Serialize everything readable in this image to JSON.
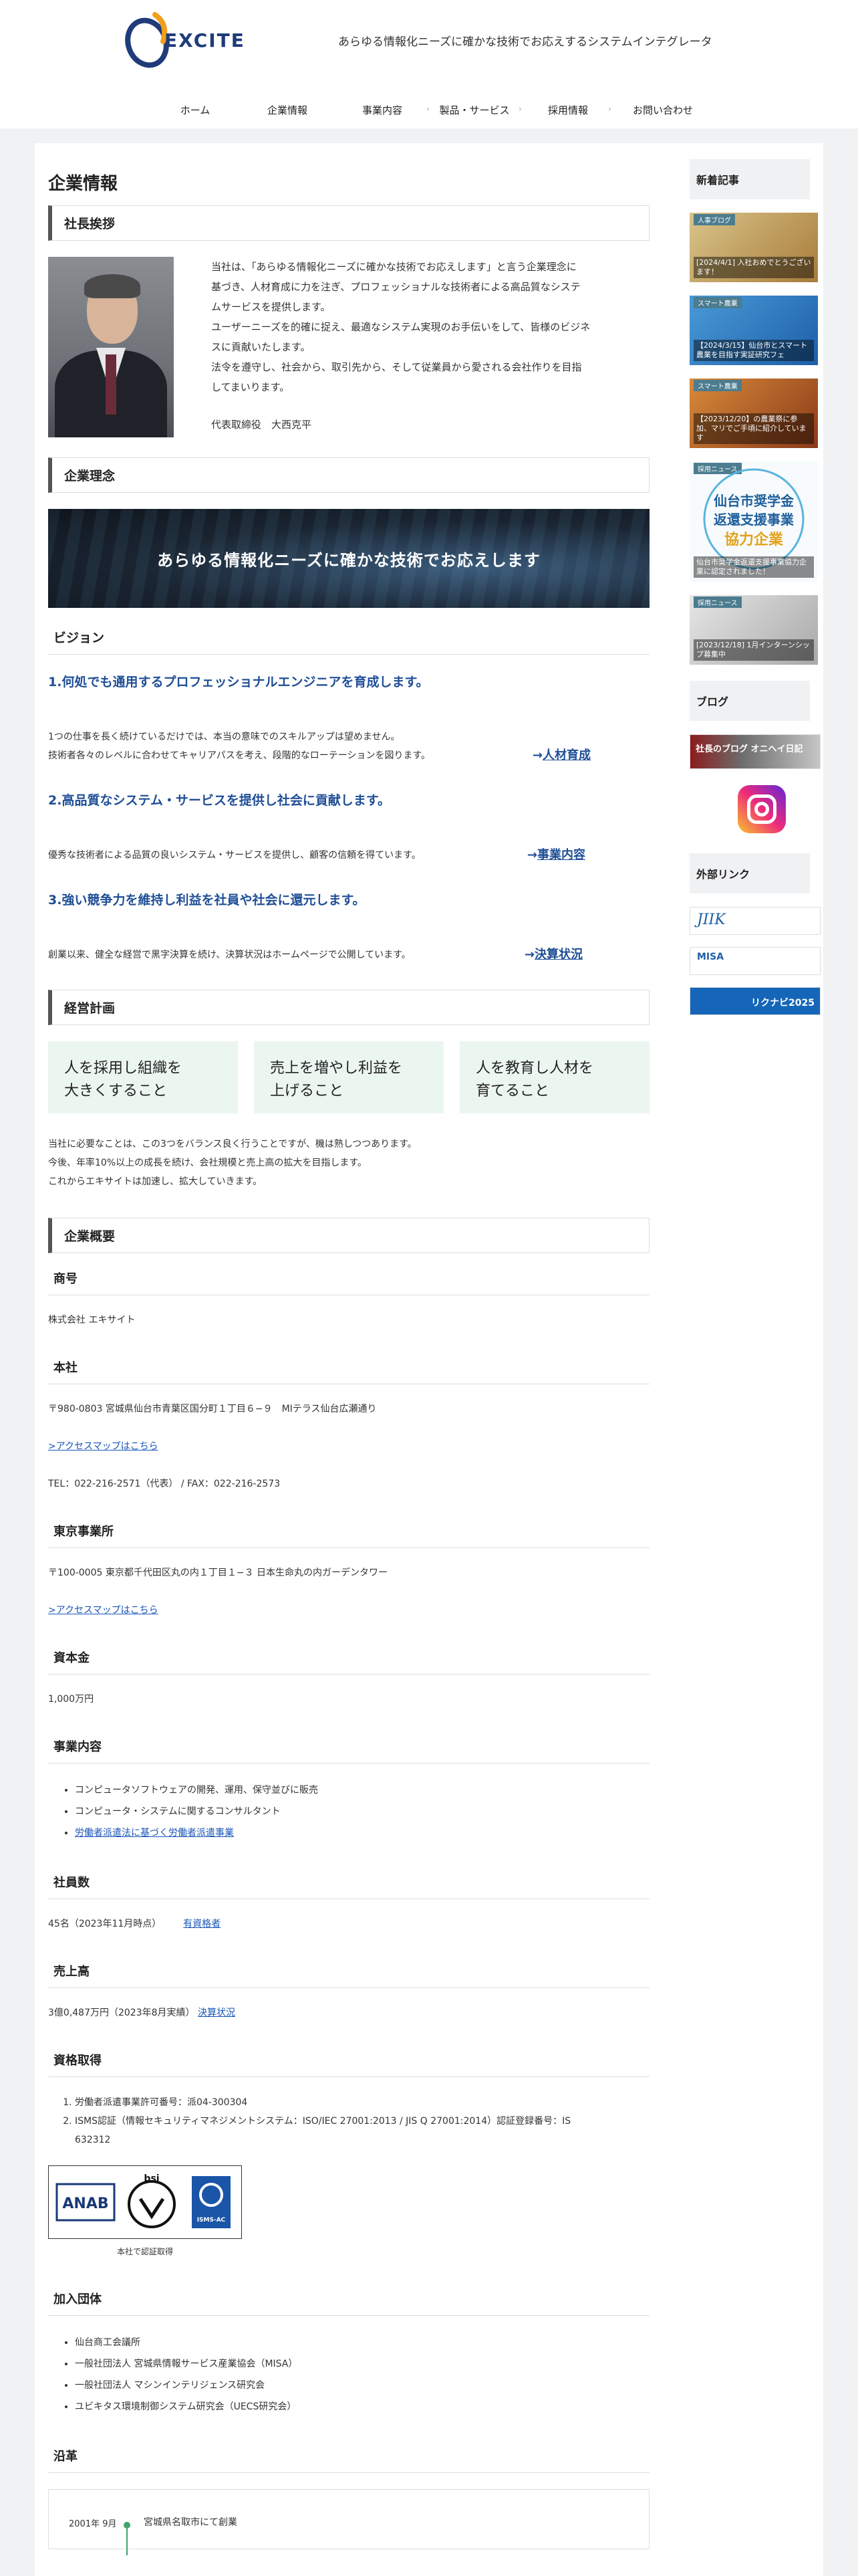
{
  "header": {
    "logo_text": "EXCITE",
    "tagline": "あらゆる情報化ニーズに確かな技術でお応えするシステムインテグレータ"
  },
  "nav": [
    "ホーム",
    "企業情報",
    "事業内容",
    "製品・サービス",
    "採用情報",
    "お問い合わせ"
  ],
  "page_title": "企業情報",
  "greeting": {
    "heading": "社長挨拶",
    "paragraphs": [
      "当社は、「あらゆる情報化ニーズに確かな技術でお応えします」と言う企業理念に",
      "基づき、人材育成に力を注ぎ、プロフェッショナルな技術者による高品質なシステ",
      "ムサービスを提供します。",
      "ユーザーニーズを的確に捉え、最適なシステム実現のお手伝いをして、皆様のビジネ",
      "スに貢献いたします。",
      "法令を遵守し、社会から、取引先から、そして従業員から愛される会社作りを目指",
      "してまいります。"
    ],
    "signature": "代表取締役　大西克平"
  },
  "philosophy": {
    "heading": "企業理念",
    "banner": "あらゆる情報化ニーズに確かな技術でお応えします"
  },
  "vision": {
    "heading": "ビジョン",
    "items": [
      {
        "title": "1.何処でも通用するプロフェッショナルエンジニアを育成します。",
        "body": [
          "1つの仕事を長く続けているだけでは、本当の意味でのスキルアップは望めません。",
          "技術者各々のレベルに合わせてキャリアパスを考え、段階的なローテーションを図ります。"
        ],
        "link": "人材育成"
      },
      {
        "title": "2.高品質なシステム・サービスを提供し社会に貢献します。",
        "body": [
          "優秀な技術者による品質の良いシステム・サービスを提供し、顧客の信頼を得ています。"
        ],
        "link": "事業内容"
      },
      {
        "title": "3.強い競争力を維持し利益を社員や社会に還元します。",
        "body": [
          "創業以来、健全な経営で黒字決算を続け、決算状況はホームページで公開しています。"
        ],
        "link": "決算状況"
      }
    ]
  },
  "plan": {
    "heading": "経営計画",
    "cards": [
      [
        "人を採用し組織を",
        "大きくすること"
      ],
      [
        "売上を増やし利益を",
        "上げること"
      ],
      [
        "人を教育し人材を",
        "育てること"
      ]
    ],
    "note": [
      "当社に必要なことは、この3つをバランス良く行うことですが、機は熟しつつあります。",
      "今後、年率10%以上の成長を続け、会社規模と売上高の拡大を目指します。",
      "これからエキサイトは加速し、拡大していきます。"
    ]
  },
  "overview": {
    "heading": "企業概要",
    "name_label": "商号",
    "name_value": "株式会社 エキサイト",
    "hq_label": "本社",
    "hq_address": "〒980-0803 宮城県仙台市青葉区国分町１丁目６−９　MIテラス仙台広瀬通り",
    "hq_map": ">アクセスマップはこちら",
    "hq_tel": "TEL：022-216-2571（代表） / FAX：022-216-2573",
    "tokyo_label": "東京事業所",
    "tokyo_address": "〒100-0005 東京都千代田区丸の内１丁目１−３ 日本生命丸の内ガーデンタワー",
    "tokyo_map": ">アクセスマップはこちら",
    "capital_label": "資本金",
    "capital_value": "1,000万円",
    "biz_label": "事業内容",
    "biz_items": [
      "コンピュータソフトウェアの開発、運用、保守並びに販売",
      "コンピュータ・システムに関するコンサルタント"
    ],
    "biz_link": "労働者派遣法に基づく労働者派遣事業",
    "staff_label": "社員数",
    "staff_value": "45名（2023年11月時点）",
    "staff_link": "有資格者",
    "sales_label": "売上高",
    "sales_value": "3億0,487万円（2023年8月実績）",
    "sales_link": "決算状況",
    "cert_label": "資格取得",
    "cert_items": [
      "労働者派遣事業許可番号：派04-300304",
      "ISMS認証（情報セキュリティマネジメントシステム：ISO/IEC 27001:2013 / JIS Q 27001:2014）認証登録番号：IS"
    ],
    "cert_item_cont": "632312",
    "cert_caption": "本社で認証取得",
    "cert_logos": [
      "ANAB",
      "bsi",
      "ISMS-AC"
    ],
    "member_label": "加入団体",
    "member_items": [
      "仙台商工会議所",
      "一般社団法人 宮城県情報サービス産業協会（MISA）",
      "一般社団法人 マシンインテリジェンス研究会",
      "ユビキタス環境制御システム研究会（UECS研究会）"
    ],
    "history_label": "沿革",
    "history_date": "2001年 9月",
    "history_event": "宮城県名取市にて創業"
  },
  "sidebar": {
    "news_heading": "新着記事",
    "news": [
      {
        "tag": "人事ブログ",
        "caption": "[2024/4/1] 入社おめでとうございます！"
      },
      {
        "tag": "スマート農業",
        "caption": "【2024/3/15】仙台市とスマート農業を目指す実証研究フェ"
      },
      {
        "tag": "スマート農業",
        "caption": "【2023/12/20】の農業祭に参加、マリでご手頃に紹介しています"
      },
      {
        "tag": "採用ニュース",
        "caption": "仙台市奨学金返還支援事業協力企業に認定されました！"
      },
      {
        "tag": "採用ニュース",
        "caption": "[2023/12/18] 1月インターンシップ募集中"
      }
    ],
    "banner_big_1": "仙台市奨学金",
    "banner_big_2": "返還支援事業",
    "banner_big_3": "協力企業",
    "blog_heading": "ブログ",
    "blog_banner": "社長のブログ オニヘイ日記",
    "links_heading": "外部リンク",
    "links": [
      "JIIK",
      "MISA",
      "リクナビ2025"
    ]
  }
}
